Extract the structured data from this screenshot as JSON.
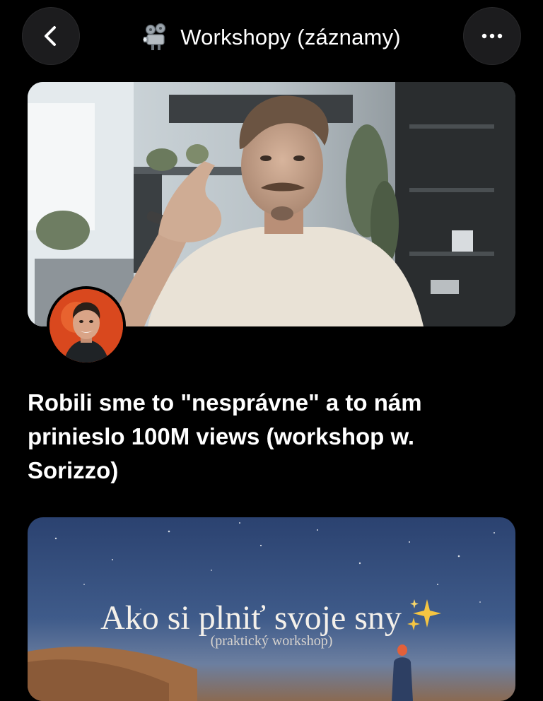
{
  "header": {
    "title": "Workshopy (záznamy)",
    "back_icon": "chevron-left-icon",
    "more_icon": "ellipsis-icon",
    "title_icon": "film-projector-icon"
  },
  "posts": [
    {
      "title": "Robili sme to \"nesprávne\" a to nám prinieslo 100M views (workshop w. Sorizzo)",
      "thumbnail": "video-frame-man-in-white-tshirt",
      "avatar": "presenter-avatar"
    },
    {
      "thumbnail_title": "Ako si plniť svoje sny",
      "thumbnail_subtitle": "(praktický workshop)",
      "thumbnail_icon": "sparkles-icon"
    }
  ],
  "colors": {
    "background": "#000000",
    "button_bg": "#1c1c1e",
    "text": "#ffffff",
    "avatar_bg": "#d9481e"
  }
}
